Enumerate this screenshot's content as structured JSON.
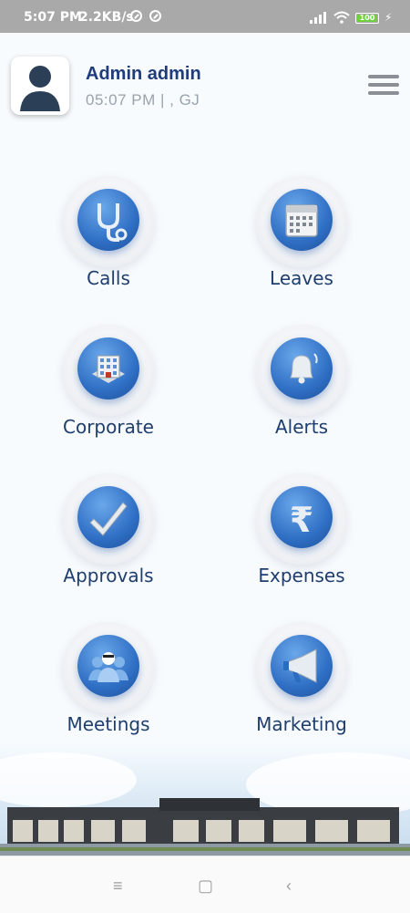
{
  "status_bar": {
    "time": "5:07 PM",
    "speed": "2.2KB/s",
    "battery": "100"
  },
  "header": {
    "user_name": "Admin admin",
    "user_meta": "05:07 PM  |  , GJ",
    "menu_icon": "hamburger-menu-icon"
  },
  "tiles": [
    {
      "label": "Calls",
      "icon": "stethoscope-icon"
    },
    {
      "label": "Leaves",
      "icon": "calendar-icon"
    },
    {
      "label": "Corporate",
      "icon": "building-icon"
    },
    {
      "label": "Alerts",
      "icon": "bell-icon"
    },
    {
      "label": "Approvals",
      "icon": "checkmark-icon"
    },
    {
      "label": "Expenses",
      "icon": "rupee-icon"
    },
    {
      "label": "Meetings",
      "icon": "group-people-icon"
    },
    {
      "label": "Marketing",
      "icon": "megaphone-icon"
    }
  ],
  "colors": {
    "accent": "#2f6fc4",
    "title": "#1f3d7a",
    "status_bar": "#a9a9a9"
  },
  "nav_bar": {
    "recent": "≡",
    "home": "▢",
    "back": "‹"
  }
}
